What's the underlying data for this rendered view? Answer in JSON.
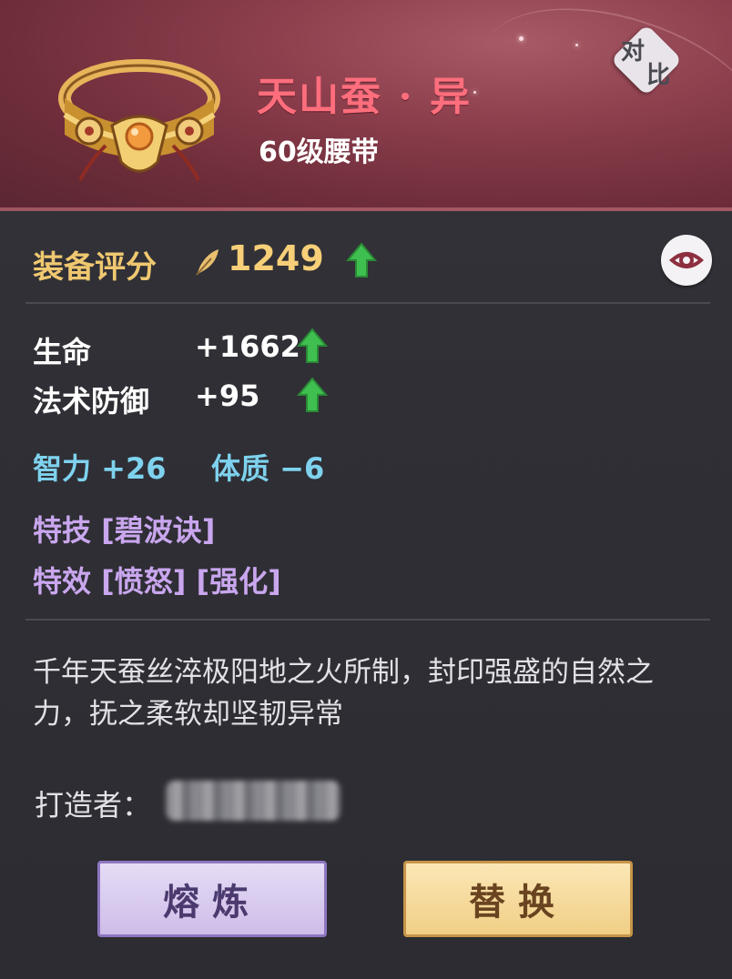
{
  "header": {
    "item_name": "天山蚕 · 异",
    "item_type": "60级腰带",
    "compare_label_1": "对",
    "compare_label_2": "比"
  },
  "score": {
    "label": "装备评分",
    "value": "1249",
    "trend": "up"
  },
  "stats": [
    {
      "label": "生命",
      "value": "+1662",
      "trend": "up"
    },
    {
      "label": "法术防御",
      "value": "+95",
      "trend": "up"
    }
  ],
  "attributes": [
    {
      "text": "智力 +26"
    },
    {
      "text": "体质 −6"
    }
  ],
  "skills": {
    "skill_line": "特技 [碧波诀]",
    "effect_line": "特效 [愤怒] [强化]"
  },
  "description": "千年天蚕丝淬极阳地之火所制，封印强盛的自然之力，抚之柔软却坚韧异常",
  "maker": {
    "label": "打造者："
  },
  "buttons": {
    "refine": "熔炼",
    "replace": "替换"
  },
  "colors": {
    "item_name": "#ff6e7d",
    "score": "#f6cf78",
    "attribute": "#7ed2ee",
    "skill": "#c9a6ee",
    "arrow_up": "#3fbf4f"
  },
  "icons": {
    "item": "belt-ring-icon",
    "score": "quill-icon",
    "view": "eye-icon",
    "trend": "arrow-up-icon"
  }
}
